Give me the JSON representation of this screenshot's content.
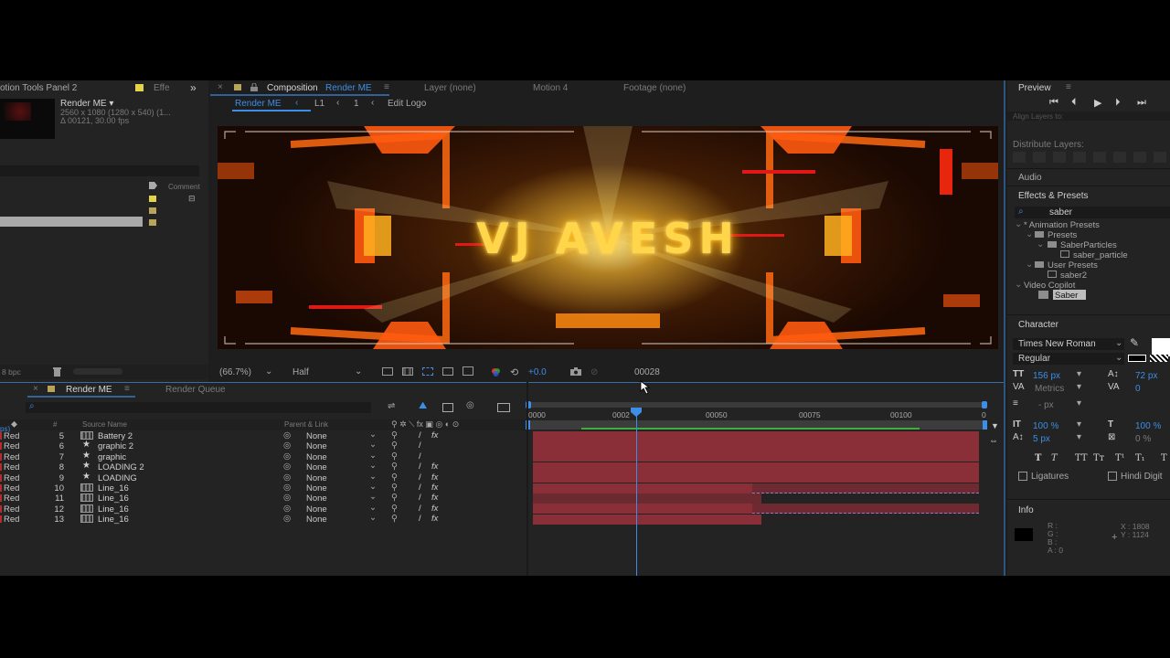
{
  "left_panel": {
    "tab_title": "otion Tools Panel 2",
    "tab_effects": "Effe",
    "comp_name": "Render ME ▾",
    "comp_dims": "2560 x 1080  (1280 x 540) (1...",
    "comp_duration": "Δ 00121, 30.00 fps",
    "comment_label": "Comment",
    "bpc": "8 bpc"
  },
  "comp_panel": {
    "tab_label": "Composition",
    "tab_comp_name": "Render ME",
    "layer_tab": "Layer (none)",
    "motion_tab": "Motion 4",
    "footage_tab": "Footage (none)",
    "breadcrumb": [
      "Render ME",
      "L1",
      "1",
      "Edit Logo"
    ],
    "viewer_text": "VJ AVESH",
    "zoom": "(66.7%)",
    "resolution": "Half",
    "exposure": "+0.0",
    "timecode": "00028"
  },
  "timeline": {
    "tab_comp": "Render ME",
    "tab_render_queue": "Render Queue",
    "search_placeholder": "",
    "col_num": "#",
    "col_source": "Source Name",
    "col_parent": "Parent & Link",
    "ruler": [
      "0000",
      "0002",
      "00050",
      "00075",
      "00100",
      "0"
    ],
    "layers": [
      {
        "label": "Red",
        "num": "5",
        "name": "Battery 2",
        "type": "comp",
        "parent": "None"
      },
      {
        "label": "Red",
        "num": "6",
        "name": "graphic 2",
        "type": "shape",
        "parent": "None"
      },
      {
        "label": "Red",
        "num": "7",
        "name": "graphic",
        "type": "shape",
        "parent": "None"
      },
      {
        "label": "Red",
        "num": "8",
        "name": "LOADING 2",
        "type": "shape",
        "parent": "None"
      },
      {
        "label": "Red",
        "num": "9",
        "name": "LOADING",
        "type": "shape",
        "parent": "None"
      },
      {
        "label": "Red",
        "num": "10",
        "name": "Line_16",
        "type": "comp",
        "parent": "None"
      },
      {
        "label": "Red",
        "num": "11",
        "name": "Line_16",
        "type": "comp",
        "parent": "None"
      },
      {
        "label": "Red",
        "num": "12",
        "name": "Line_16",
        "type": "comp",
        "parent": "None"
      },
      {
        "label": "Red",
        "num": "13",
        "name": "Line_16",
        "type": "comp",
        "parent": "None"
      }
    ],
    "row_prefix": "ps)"
  },
  "right_panel": {
    "preview_title": "Preview",
    "align_partial": "Align Layers to:",
    "distribute_label": "Distribute Layers:",
    "audio_label": "Audio",
    "effects_title": "Effects & Presets",
    "search_value": "saber",
    "tree": [
      {
        "label": "* Animation Presets",
        "depth": 0,
        "icon": "chevron"
      },
      {
        "label": "Presets",
        "depth": 1,
        "icon": "folder"
      },
      {
        "label": "SaberParticles",
        "depth": 2,
        "icon": "folder"
      },
      {
        "label": "saber_particle",
        "depth": 3,
        "icon": "preset"
      },
      {
        "label": "User Presets",
        "depth": 1,
        "icon": "folder"
      },
      {
        "label": "saber2",
        "depth": 2,
        "icon": "preset"
      },
      {
        "label": "Video Copilot",
        "depth": 0,
        "icon": "chevron"
      },
      {
        "label": "Saber",
        "depth": 1,
        "icon": "effect",
        "selected": true
      }
    ],
    "character_title": "Character",
    "font_family": "Times New Roman",
    "font_style": "Regular",
    "font_size": "156 px",
    "leading": "72 px",
    "kerning": "Metrics",
    "tracking": "0",
    "line_spacing": "- px",
    "vscale": "100 %",
    "hscale": "100 %",
    "baseline": "5 px",
    "tsume": "0 %",
    "ligatures": "Ligatures",
    "hindi_digits": "Hindi Digit",
    "info_title": "Info",
    "info_rgba": [
      "R :",
      "G :",
      "B :",
      "A :  0"
    ],
    "info_x": "X : 1808",
    "info_y": "Y : 1124"
  },
  "colors": {
    "accent": "#3d8ee6",
    "layer_bar": "#8a2f38",
    "label_red": "#b52c2c",
    "panel_bg": "#232323"
  }
}
